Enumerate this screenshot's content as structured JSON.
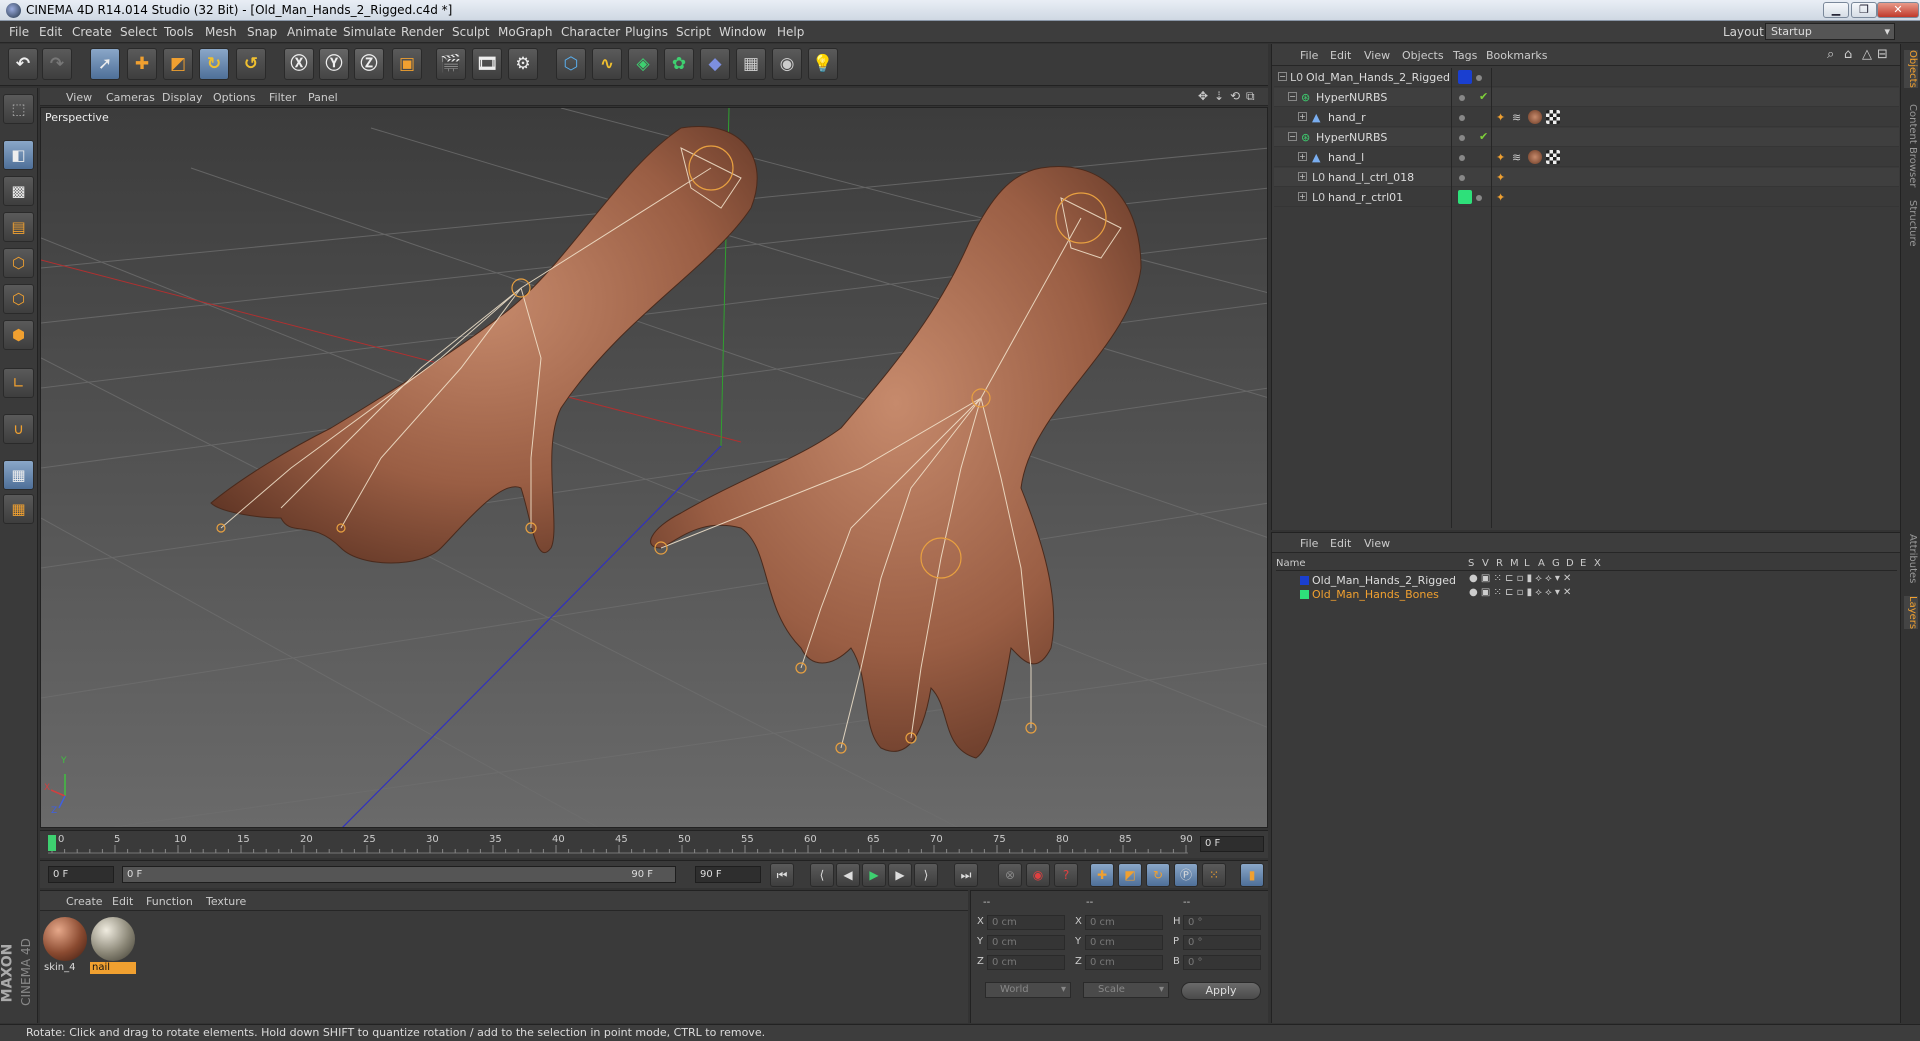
{
  "window": {
    "title": "CINEMA 4D R14.014 Studio (32 Bit) - [Old_Man_Hands_2_Rigged.c4d *]",
    "minimize": "▁",
    "restore": "❐",
    "close": "✕"
  },
  "menu": [
    "File",
    "Edit",
    "Create",
    "Select",
    "Tools",
    "Mesh",
    "Snap",
    "Animate",
    "Simulate",
    "Render",
    "Sculpt",
    "MoGraph",
    "Character",
    "Plugins",
    "Script",
    "Window",
    "Help"
  ],
  "layout": {
    "label": "Layout:",
    "value": "Startup"
  },
  "viewport": {
    "menu": [
      "View",
      "Cameras",
      "Display",
      "Options",
      "Filter",
      "Panel"
    ],
    "camera": "Perspective",
    "axis": {
      "x": "X",
      "y": "Y",
      "z": "Z"
    }
  },
  "timeline": {
    "ticks": [
      "0",
      "5",
      "10",
      "15",
      "20",
      "25",
      "30",
      "35",
      "40",
      "45",
      "50",
      "55",
      "60",
      "65",
      "70",
      "75",
      "80",
      "85",
      "90"
    ],
    "current_frame": "0 F"
  },
  "transport": {
    "start": "0 F",
    "range_start": "0 F",
    "range_end": "90 F",
    "end": "90 F"
  },
  "materials": {
    "menu": [
      "Create",
      "Edit",
      "Function",
      "Texture"
    ],
    "items": [
      {
        "label": "skin_4"
      },
      {
        "label": "nail"
      }
    ]
  },
  "coords": {
    "header_left": "--",
    "header_mid": "--",
    "header_right": "--",
    "rows": [
      {
        "a": "X",
        "av": "0 cm",
        "b": "X",
        "bv": "0 cm",
        "c": "H",
        "cv": "0 °"
      },
      {
        "a": "Y",
        "av": "0 cm",
        "b": "Y",
        "bv": "0 cm",
        "c": "P",
        "cv": "0 °"
      },
      {
        "a": "Z",
        "av": "0 cm",
        "b": "Z",
        "bv": "0 cm",
        "c": "B",
        "cv": "0 °"
      }
    ],
    "mode1": "World",
    "mode2": "Scale",
    "apply": "Apply"
  },
  "objects": {
    "menu": [
      "File",
      "Edit",
      "View",
      "Objects",
      "Tags",
      "Bookmarks"
    ],
    "items": [
      {
        "name": "Old_Man_Hands_2_Rigged",
        "tag": "#1a3fd0"
      },
      {
        "name": "HyperNURBS"
      },
      {
        "name": "hand_r"
      },
      {
        "name": "HyperNURBS"
      },
      {
        "name": "hand_l"
      },
      {
        "name": "hand_l_ctrl_018"
      },
      {
        "name": "hand_r_ctrl01",
        "tag": "#2ee07a"
      }
    ]
  },
  "layers": {
    "menu": [
      "File",
      "Edit",
      "View"
    ],
    "columns": [
      "Name",
      "S",
      "V",
      "R",
      "M",
      "L",
      "A",
      "G",
      "D",
      "E",
      "X"
    ],
    "items": [
      {
        "name": "Old_Man_Hands_2_Rigged",
        "color": "#1a3fd0",
        "text_color": "#dddddd"
      },
      {
        "name": "Old_Man_Hands_Bones",
        "color": "#2ee07a",
        "text_color": "#f0a030"
      }
    ]
  },
  "side_tabs": [
    "Objects",
    "Content Browser",
    "Structure",
    "Attributes",
    "Layers"
  ],
  "brand": {
    "name": "MAXON",
    "product": "CINEMA 4D"
  },
  "status": "Rotate: Click and drag to rotate elements. Hold down SHIFT to quantize rotation / add to the selection in point mode, CTRL to remove."
}
